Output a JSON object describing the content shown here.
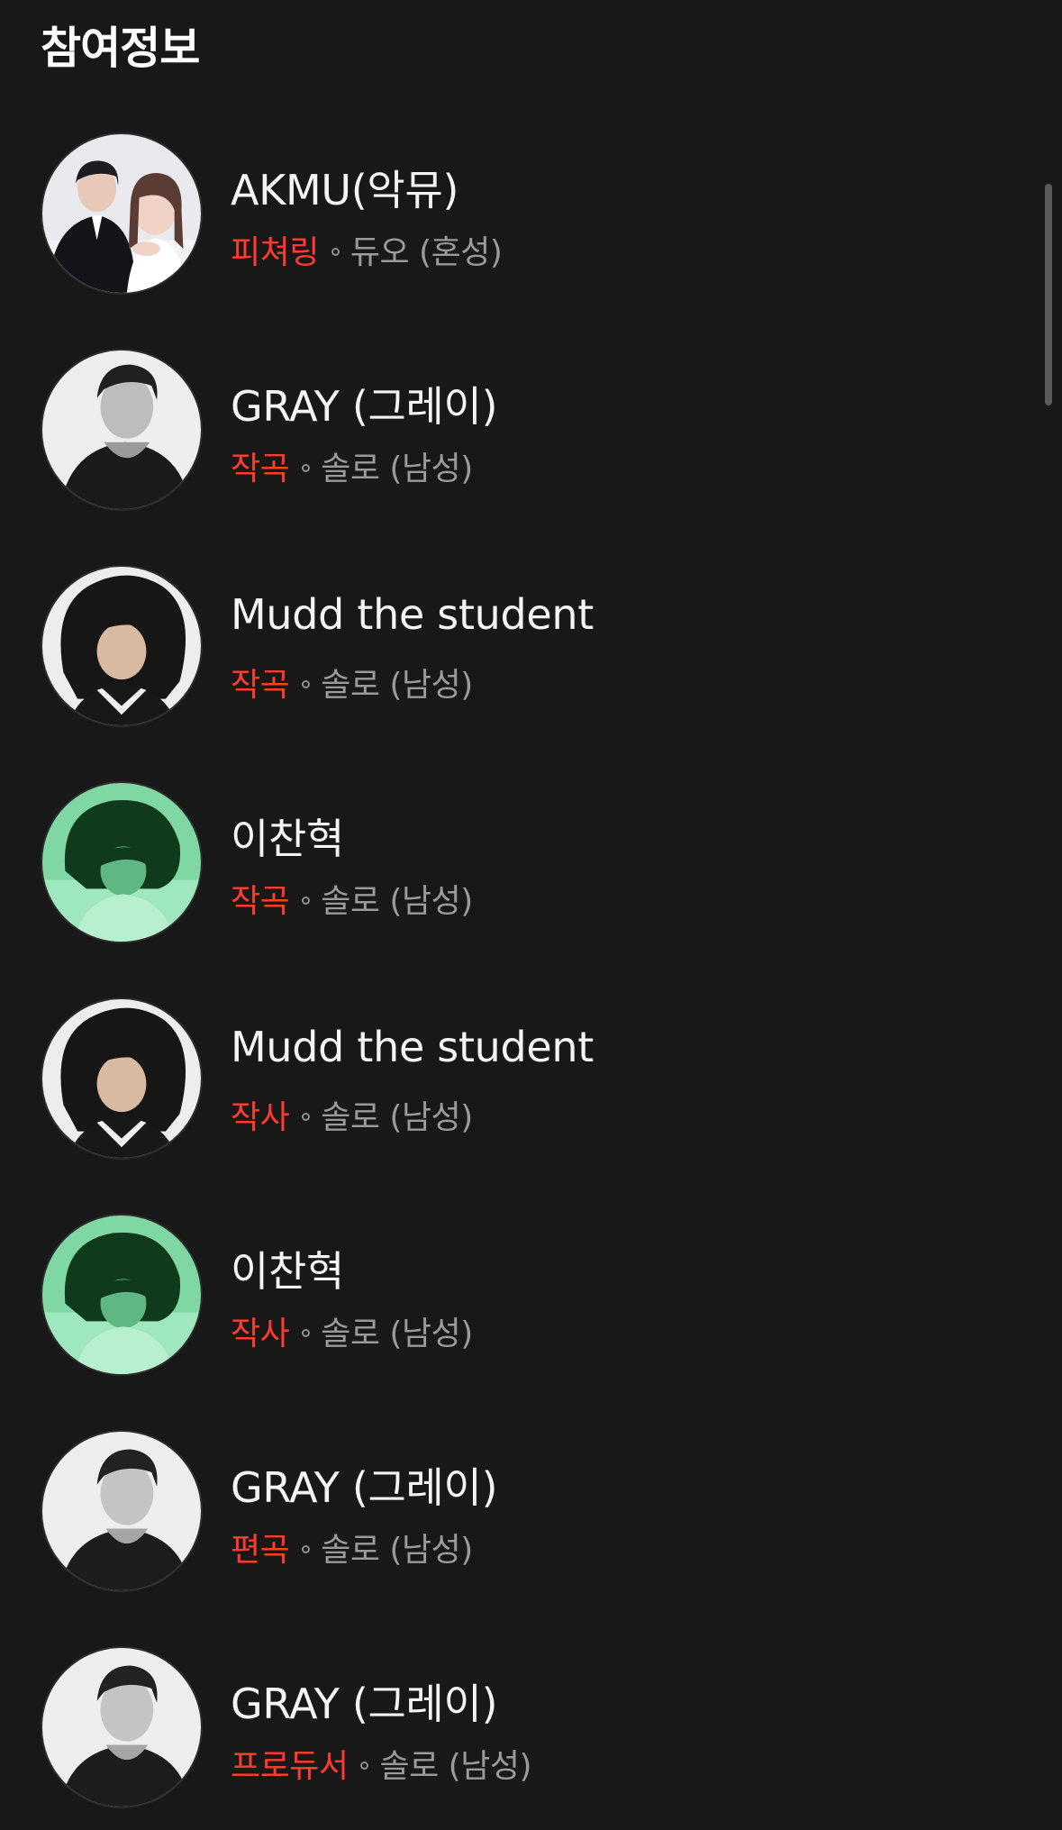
{
  "section": {
    "title": "참여정보"
  },
  "credits": [
    {
      "name": "AKMU(악뮤)",
      "role": "피쳐링",
      "type": "듀오 (혼성)",
      "avatar": "akmu-duo"
    },
    {
      "name": "GRAY (그레이)",
      "role": "작곡",
      "type": "솔로 (남성)",
      "avatar": "gray-bw"
    },
    {
      "name": "Mudd the student",
      "role": "작곡",
      "type": "솔로 (남성)",
      "avatar": "mudd"
    },
    {
      "name": "이찬혁",
      "role": "작곡",
      "type": "솔로 (남성)",
      "avatar": "chanhyuk-green"
    },
    {
      "name": "Mudd the student",
      "role": "작사",
      "type": "솔로 (남성)",
      "avatar": "mudd"
    },
    {
      "name": "이찬혁",
      "role": "작사",
      "type": "솔로 (남성)",
      "avatar": "chanhyuk-green"
    },
    {
      "name": "GRAY (그레이)",
      "role": "편곡",
      "type": "솔로 (남성)",
      "avatar": "gray-bw"
    },
    {
      "name": "GRAY (그레이)",
      "role": "프로듀서",
      "type": "솔로 (남성)",
      "avatar": "gray-bw"
    }
  ],
  "colors": {
    "background": "#181818",
    "role_accent": "#ff3b30",
    "secondary_text": "#9a9a9a",
    "primary_text": "#f4f4f4"
  }
}
